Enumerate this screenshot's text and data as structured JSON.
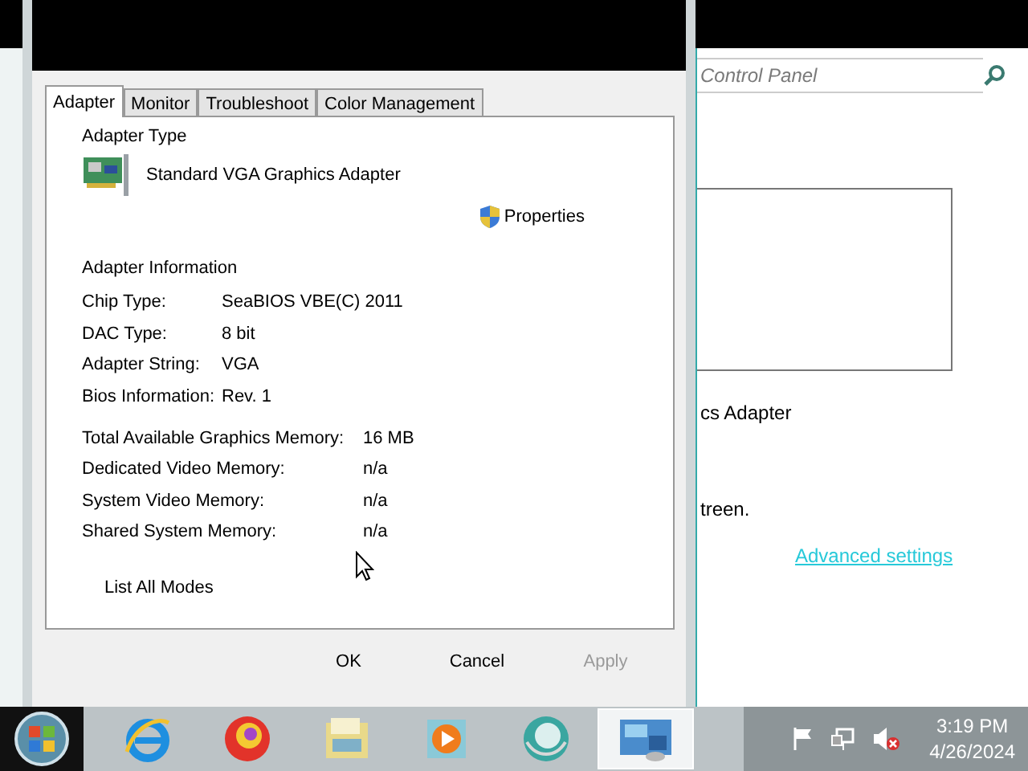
{
  "dialog": {
    "tabs": [
      {
        "label": "Adapter",
        "selected": true
      },
      {
        "label": "Monitor",
        "selected": false
      },
      {
        "label": "Troubleshoot",
        "selected": false
      },
      {
        "label": "Color Management",
        "selected": false
      }
    ],
    "adapter_type": {
      "heading": "Adapter Type",
      "name": "Standard VGA Graphics Adapter",
      "properties_button": "Properties"
    },
    "adapter_information": {
      "heading": "Adapter Information",
      "rows": [
        {
          "label": "Chip Type:",
          "value": "SeaBIOS VBE(C) 2011"
        },
        {
          "label": "DAC Type:",
          "value": "8 bit"
        },
        {
          "label": "Adapter String:",
          "value": "VGA"
        },
        {
          "label": "Bios Information:",
          "value": "Rev. 1"
        }
      ]
    },
    "memory": [
      {
        "label": "Total Available Graphics Memory:",
        "value": "16 MB"
      },
      {
        "label": "Dedicated Video Memory:",
        "value": "n/a"
      },
      {
        "label": "System Video Memory:",
        "value": "n/a"
      },
      {
        "label": "Shared System Memory:",
        "value": "n/a"
      }
    ],
    "list_modes_button": "List All Modes",
    "buttons": [
      {
        "label": "OK",
        "disabled": false
      },
      {
        "label": "Cancel",
        "disabled": false
      },
      {
        "label": "Apply",
        "disabled": true
      }
    ]
  },
  "background_window": {
    "search": {
      "placeholder": "Control Panel"
    },
    "texts": [
      "cs Adapter",
      "treen."
    ],
    "link": "Advanced settings"
  },
  "taskbar": {
    "apps": [
      {
        "kind": "browser",
        "selected": false
      },
      {
        "kind": "firefox",
        "selected": false
      },
      {
        "kind": "folder",
        "selected": false
      },
      {
        "kind": "media",
        "selected": false
      },
      {
        "kind": "globe",
        "selected": false
      },
      {
        "kind": "display",
        "selected": true
      }
    ],
    "clock": {
      "time": "3:19 PM",
      "date": "4/26/2024"
    }
  }
}
